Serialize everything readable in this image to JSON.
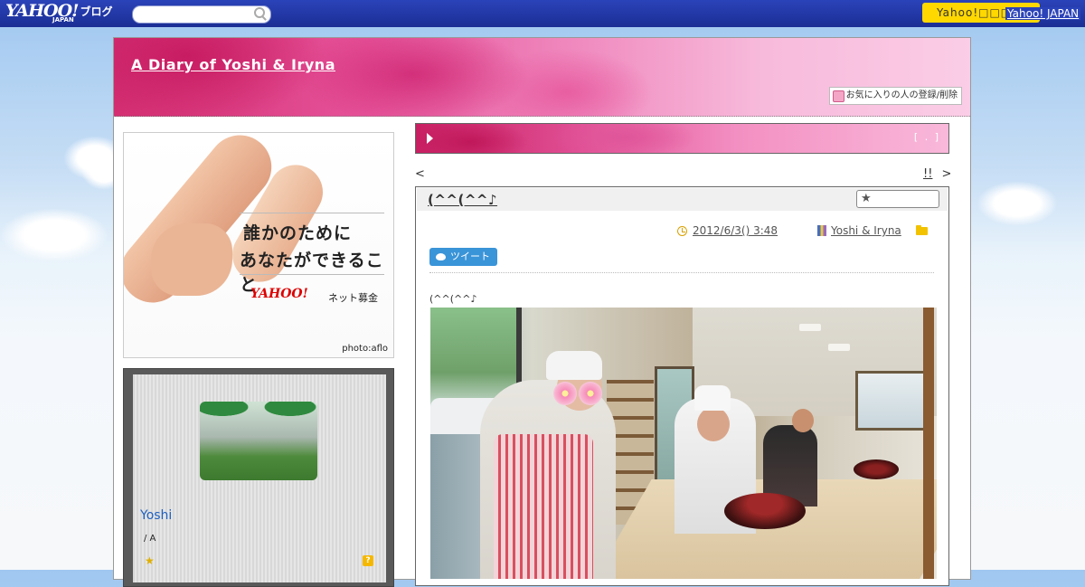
{
  "topbar": {
    "logo_text": "YAHOO!",
    "logo_sub": "JAPAN",
    "blog_label": "ブログ",
    "search_placeholder": "",
    "yahoo_button": "Yahoo!□□□",
    "yahoo_link": "Yahoo! JAPAN"
  },
  "header": {
    "blog_title": "A Diary of Yoshi & Iryna",
    "favorite_button": "お気に入りの人の登録/削除"
  },
  "banner": {
    "line1": "誰かのために",
    "line2": "あなたができること",
    "logo": "YAHOO!",
    "logo_sub": "JAPAN",
    "service": "ネット募金",
    "credit": "photo:aflo"
  },
  "profile": {
    "name": "Yoshi",
    "subtitle": "/ A",
    "star_icon": "star-icon",
    "question_icon": "question-icon"
  },
  "rose_bar": {
    "bracket_text": "[ . ]"
  },
  "navigation": {
    "prev": "<",
    "next_marker": "!!",
    "next": ">"
  },
  "article": {
    "title": "(^^(^^♪",
    "date": "2012/6/3()  3:48",
    "author": "Yoshi & Iryna",
    "tweet_label": "ツイート",
    "body_text": "(^^(^^♪",
    "photo_icon": "photo-image"
  }
}
